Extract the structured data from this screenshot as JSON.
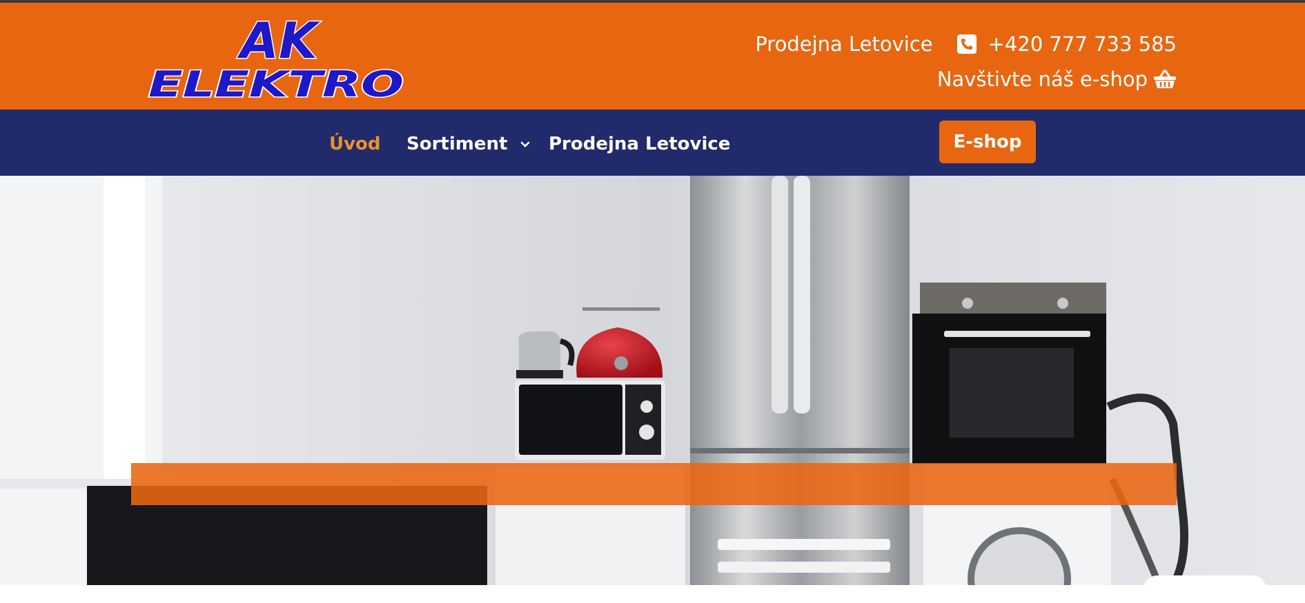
{
  "colors": {
    "header_bg": "#e96611",
    "nav_bg": "#212a6a",
    "active_nav": "#e9932b",
    "logo_blue": "#1f17c8",
    "white": "#ffffff"
  },
  "logo": {
    "line1": "AK",
    "line2": "ELEKTRO"
  },
  "contact": {
    "store": "Prodejna Letovice",
    "phone_icon": "phone-icon",
    "phone": "+420 777 733 585",
    "eshop_text": "Navštivte náš e-shop",
    "basket_icon": "basket-icon"
  },
  "nav": {
    "items": [
      {
        "label": "Úvod",
        "active": true
      },
      {
        "label": "Sortiment",
        "dropdown": true
      },
      {
        "label": "Prodejna Letovice"
      }
    ],
    "button": "E-shop"
  },
  "hero": {
    "image": "kitchen-appliances-photo",
    "banner_text": ""
  }
}
